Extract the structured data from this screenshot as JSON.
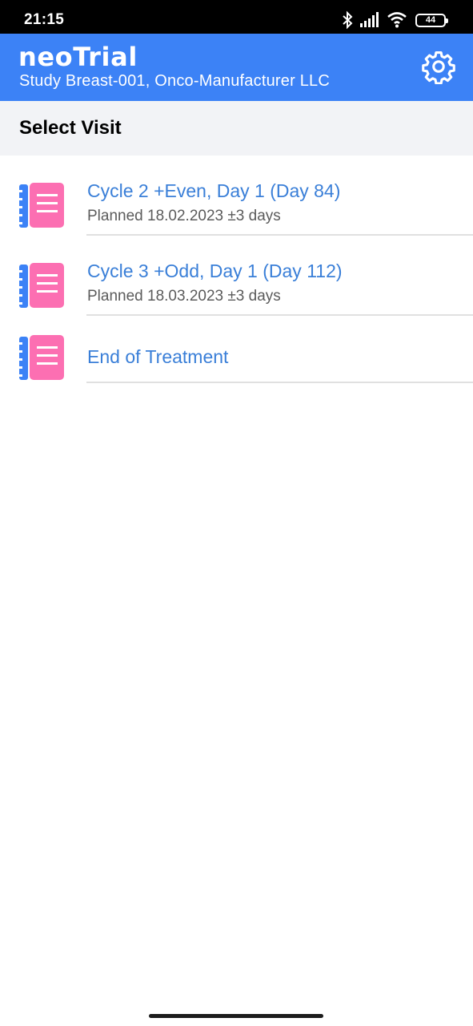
{
  "status_bar": {
    "time": "21:15",
    "battery": "44",
    "icons": [
      "bluetooth-icon",
      "signal-icon",
      "wifi-icon",
      "battery-icon"
    ]
  },
  "header": {
    "app_name": "neoTrial",
    "subtitle": "Study Breast-001, Onco-Manufacturer LLC",
    "settings_icon": "gear-icon",
    "background_color": "#3c82f6"
  },
  "section": {
    "title": "Select Visit"
  },
  "visits": [
    {
      "title": "Cycle 2 +Even, Day 1 (Day 84)",
      "planned": "Planned 18.02.2023 ±3 days",
      "icon": "notebook-icon"
    },
    {
      "title": "Cycle 3 +Odd, Day 1 (Day 112)",
      "planned": "Planned 18.03.2023 ±3 days",
      "icon": "notebook-icon"
    },
    {
      "title": "End of Treatment",
      "icon": "notebook-icon"
    }
  ],
  "colors": {
    "accent": "#3c82f6",
    "link_text": "#3a7fd8",
    "notebook_pink": "#fc6fb2",
    "notebook_spine": "#3c82f6"
  }
}
